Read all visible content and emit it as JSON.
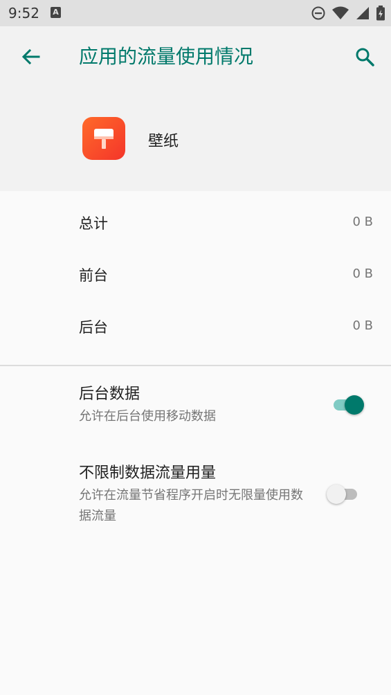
{
  "status_bar": {
    "time": "9:52",
    "notification_icon": "A",
    "icons": [
      "do-not-disturb-icon",
      "wifi-icon",
      "cellular-icon",
      "battery-icon"
    ]
  },
  "header": {
    "title": "应用的流量使用情况",
    "back_icon": "arrow-back-icon",
    "search_icon": "search-icon",
    "accent_color": "#00796b"
  },
  "app": {
    "name": "壁纸",
    "icon": "paint-brush-icon"
  },
  "usage": [
    {
      "label": "总计",
      "value": "0 B"
    },
    {
      "label": "前台",
      "value": "0 B"
    },
    {
      "label": "后台",
      "value": "0 B"
    }
  ],
  "settings": [
    {
      "title": "后台数据",
      "summary": "允许在后台使用移动数据",
      "enabled": true
    },
    {
      "title": "不限制数据流量用量",
      "summary": "允许在流量节省程序开启时无限量使用数据流量",
      "enabled": false
    }
  ]
}
